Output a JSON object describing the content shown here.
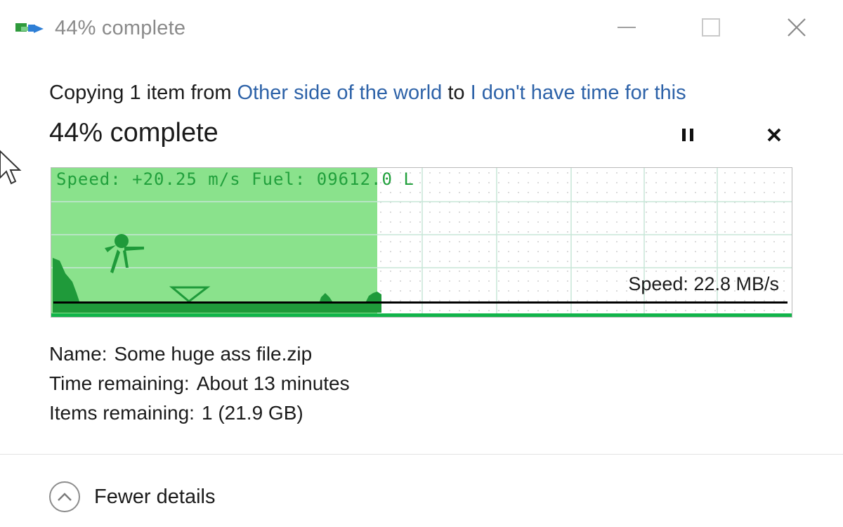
{
  "window": {
    "title": "44% complete",
    "icons": {
      "app": "copy-files-icon",
      "minimize": "minimize-icon",
      "maximize": "maximize-icon",
      "close": "close-icon"
    }
  },
  "copy": {
    "prefix": "Copying 1 item from ",
    "source": "Other side of the world",
    "middle": " to ",
    "destination": "I don't have time for this",
    "link_color": "#2d62a8"
  },
  "progress": {
    "heading": "44% complete",
    "percent": 44,
    "fill_color": "#8ae28c",
    "strip_color": "#12b44a",
    "pause_icon": "pause-icon",
    "cancel_icon": "cancel-icon"
  },
  "graph": {
    "hud_text": "Speed: +20.25 m/s Fuel: 09612.0 L",
    "hud_color": "#21a03c",
    "speed_text": "Speed: 22.8 MB/s"
  },
  "details": {
    "name_label": "Name:",
    "name_value": "Some huge ass file.zip",
    "time_label": "Time remaining:",
    "time_value": "About 13 minutes",
    "items_label": "Items remaining:",
    "items_value": "1 (21.9 GB)"
  },
  "footer": {
    "fewer_label": "Fewer details",
    "fewer_icon": "chevron-up-icon"
  }
}
